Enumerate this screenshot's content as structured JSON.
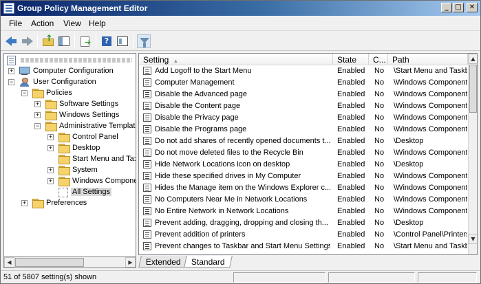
{
  "window": {
    "title": "Group Policy Management Editor"
  },
  "caption_buttons": {
    "minimize": "_",
    "maximize": "□",
    "close": "✕"
  },
  "menu": [
    "File",
    "Action",
    "View",
    "Help"
  ],
  "toolbar": [
    "back-icon",
    "forward-icon",
    "up-folder-icon",
    "show-hide-tree-icon",
    "export-list-icon",
    "help-icon",
    "properties-icon",
    "filter-icon"
  ],
  "tree": {
    "items": [
      {
        "label": "Computer Configuration",
        "expander": "+"
      },
      {
        "label": "User Configuration",
        "expander": "−"
      },
      {
        "label": "Policies",
        "expander": "−"
      },
      {
        "label": "Software Settings",
        "expander": "+"
      },
      {
        "label": "Windows Settings",
        "expander": "+"
      },
      {
        "label": "Administrative Templat",
        "expander": "−"
      },
      {
        "label": "Control Panel",
        "expander": "+"
      },
      {
        "label": "Desktop",
        "expander": "+"
      },
      {
        "label": "Start Menu and Ta:",
        "expander": ""
      },
      {
        "label": "System",
        "expander": "+"
      },
      {
        "label": "Windows Compone",
        "expander": "+"
      },
      {
        "label": "All Settings",
        "expander": ""
      },
      {
        "label": "Preferences",
        "expander": "+"
      }
    ]
  },
  "list": {
    "columns": [
      "Setting",
      "State",
      "C...",
      "Path"
    ],
    "sort_indicator": "▲",
    "rows": [
      {
        "setting": "Add Logoff to the Start Menu",
        "state": "Enabled",
        "comment": "No",
        "path": "\\Start Menu and Taskb"
      },
      {
        "setting": "Computer Management",
        "state": "Enabled",
        "comment": "No",
        "path": "\\Windows Components"
      },
      {
        "setting": "Disable the Advanced page",
        "state": "Enabled",
        "comment": "No",
        "path": "\\Windows Components"
      },
      {
        "setting": "Disable the Content page",
        "state": "Enabled",
        "comment": "No",
        "path": "\\Windows Components"
      },
      {
        "setting": "Disable the Privacy page",
        "state": "Enabled",
        "comment": "No",
        "path": "\\Windows Components"
      },
      {
        "setting": "Disable the Programs page",
        "state": "Enabled",
        "comment": "No",
        "path": "\\Windows Components"
      },
      {
        "setting": "Do not add shares of recently opened documents t...",
        "state": "Enabled",
        "comment": "No",
        "path": "\\Desktop"
      },
      {
        "setting": "Do not move deleted files to the Recycle Bin",
        "state": "Enabled",
        "comment": "No",
        "path": "\\Windows Components"
      },
      {
        "setting": "Hide Network Locations icon on desktop",
        "state": "Enabled",
        "comment": "No",
        "path": "\\Desktop"
      },
      {
        "setting": "Hide these specified drives in My Computer",
        "state": "Enabled",
        "comment": "No",
        "path": "\\Windows Components"
      },
      {
        "setting": "Hides the Manage item on the Windows Explorer c...",
        "state": "Enabled",
        "comment": "No",
        "path": "\\Windows Components"
      },
      {
        "setting": "No Computers Near Me in Network Locations",
        "state": "Enabled",
        "comment": "No",
        "path": "\\Windows Components"
      },
      {
        "setting": "No Entire Network in Network Locations",
        "state": "Enabled",
        "comment": "No",
        "path": "\\Windows Components"
      },
      {
        "setting": "Prevent adding, dragging, dropping and closing th...",
        "state": "Enabled",
        "comment": "No",
        "path": "\\Desktop"
      },
      {
        "setting": "Prevent addition of printers",
        "state": "Enabled",
        "comment": "No",
        "path": "\\Control Panel\\Printers"
      },
      {
        "setting": "Prevent changes to Taskbar and Start Menu Settings",
        "state": "Enabled",
        "comment": "No",
        "path": "\\Start Menu and Taskb"
      }
    ]
  },
  "tabs": [
    "Extended",
    "Standard"
  ],
  "status": {
    "text": "51 of 5807 setting(s) shown"
  }
}
